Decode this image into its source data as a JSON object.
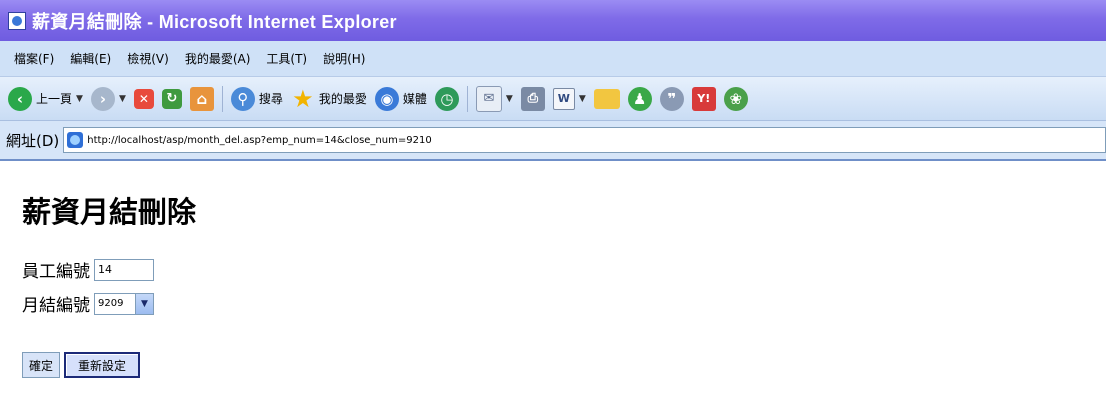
{
  "window": {
    "title": "薪資月結刪除 - Microsoft Internet Explorer"
  },
  "menu": {
    "items": [
      "檔案(F)",
      "編輯(E)",
      "檢視(V)",
      "我的最愛(A)",
      "工具(T)",
      "說明(H)"
    ]
  },
  "toolbar": {
    "back_label": "上一頁",
    "search_label": "搜尋",
    "favorites_label": "我的最愛",
    "media_label": "媒體"
  },
  "address": {
    "label": "網址(D)",
    "url": "http://localhost/asp/month_del.asp?emp_num=14&close_num=9210"
  },
  "page": {
    "title": "薪資月結刪除",
    "employee_label": "員工編號",
    "employee_value": "14",
    "closing_label": "月結編號",
    "closing_value": "9209",
    "submit_label": "確定",
    "reset_label": "重新設定"
  },
  "colors": {
    "titlebar": "#7f6be8",
    "menubar": "#cfe1f7",
    "toolbar": "#d6e5f8"
  }
}
